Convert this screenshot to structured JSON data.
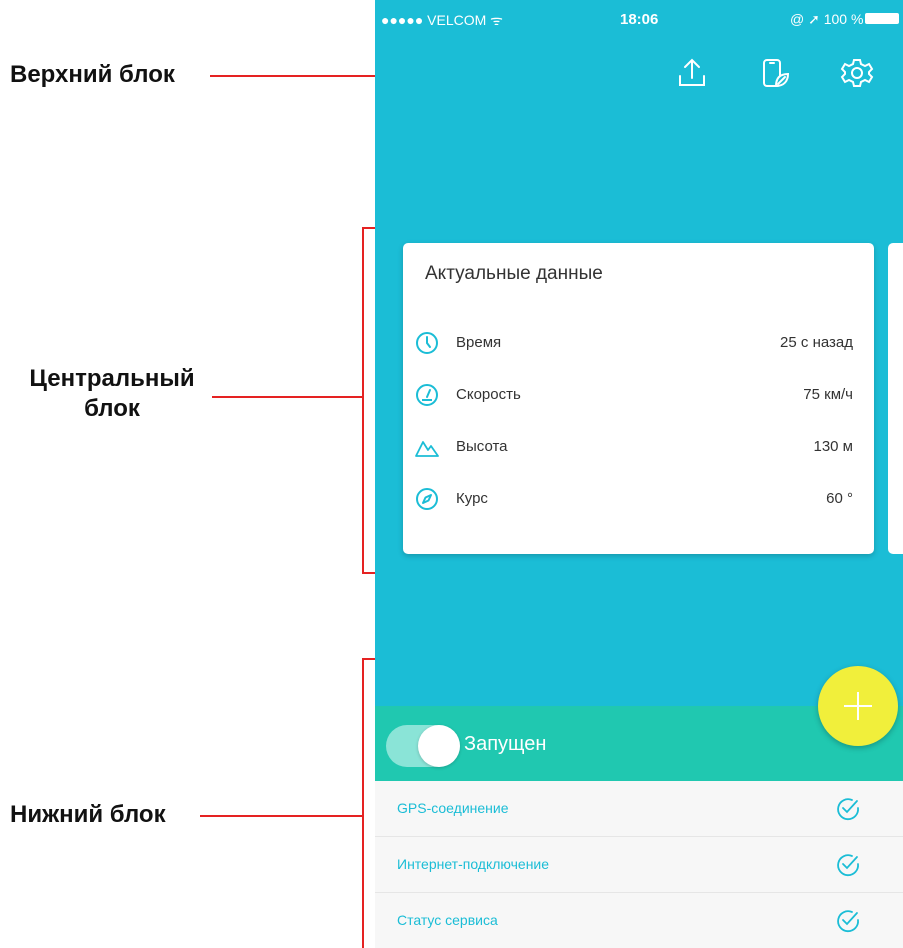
{
  "annotations": {
    "top_block": "Верхний блок",
    "center_block_line1": "Центральный",
    "center_block_line2": "блок",
    "bottom_block": "Нижний блок"
  },
  "statusbar": {
    "carrier": "●●●●● VELCOM ᯤ",
    "time": "18:06",
    "battery": "@ ➚ 100 %"
  },
  "toolbar": {
    "icons": [
      "upload-icon",
      "phone-leaf-icon",
      "gear-icon"
    ]
  },
  "card": {
    "title": "Актуальные данные",
    "rows": [
      {
        "icon": "clock-icon",
        "label": "Время",
        "value": "25 с назад"
      },
      {
        "icon": "speedometer-icon",
        "label": "Скорость",
        "value": "75 км/ч"
      },
      {
        "icon": "mountain-icon",
        "label": "Высота",
        "value": "130 м"
      },
      {
        "icon": "compass-icon",
        "label": "Курс",
        "value": "60 °"
      }
    ]
  },
  "service": {
    "state_label": "Запущен",
    "toggle_on": true
  },
  "status_items": [
    {
      "label": "GPS-соединение",
      "icon": "check-circle-icon"
    },
    {
      "label": "Интернет-подключение",
      "icon": "check-circle-icon"
    },
    {
      "label": "Статус сервиса",
      "icon": "check-circle-icon"
    }
  ],
  "colors": {
    "primary": "#1bbdd6",
    "running_bar": "#20c8b0",
    "fab": "#f1ef3b",
    "annotation": "#e52222"
  }
}
